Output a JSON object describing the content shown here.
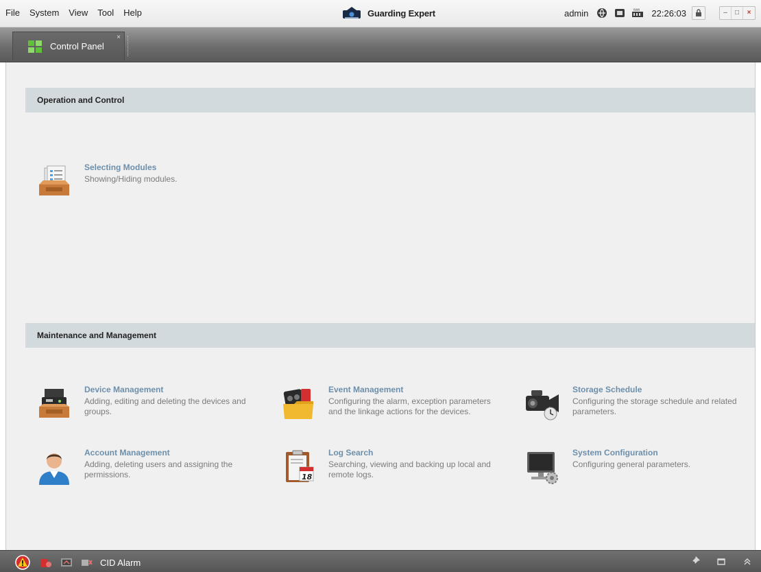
{
  "menu": {
    "items": [
      {
        "label": "File"
      },
      {
        "label": "System"
      },
      {
        "label": "View"
      },
      {
        "label": "Tool"
      },
      {
        "label": "Help"
      }
    ]
  },
  "app": {
    "title": "Guarding Expert",
    "user": "admin",
    "time": "22:26:03"
  },
  "tabs": [
    {
      "label": "Control Panel",
      "icon": "control-panel-icon",
      "close": "×"
    }
  ],
  "window_controls": {
    "minimize": "–",
    "maximize": "□",
    "close": "×"
  },
  "sections": [
    {
      "title": "Operation and Control",
      "modules": [
        {
          "title": "Selecting Modules",
          "desc": "Showing/Hiding modules.",
          "icon": "selecting-modules-icon"
        }
      ]
    },
    {
      "title": "Maintenance and Management",
      "modules": [
        {
          "title": "Device Management",
          "desc": "Adding, editing and deleting the devices and groups.",
          "icon": "device-management-icon"
        },
        {
          "title": "Event Management",
          "desc": "Configuring the alarm, exception parameters and the linkage actions for the devices.",
          "icon": "event-management-icon"
        },
        {
          "title": "Storage Schedule",
          "desc": "Configuring the storage schedule and related parameters.",
          "icon": "storage-schedule-icon"
        },
        {
          "title": "Account Management",
          "desc": "Adding, deleting users and assigning the permissions.",
          "icon": "account-management-icon"
        },
        {
          "title": "Log Search",
          "desc": "Searching, viewing and backing up local and remote logs.",
          "icon": "log-search-icon"
        },
        {
          "title": "System Configuration",
          "desc": "Configuring general parameters.",
          "icon": "system-configuration-icon"
        }
      ]
    }
  ],
  "log_search_icon_day": "18",
  "bottombar": {
    "alarm_label": "CID Alarm"
  },
  "colors": {
    "module_title": "#6d8fab",
    "section_header_bg": "#d3dadd",
    "tabbar_bg": "#6e6e6e",
    "alert_red": "#d32f2f"
  }
}
